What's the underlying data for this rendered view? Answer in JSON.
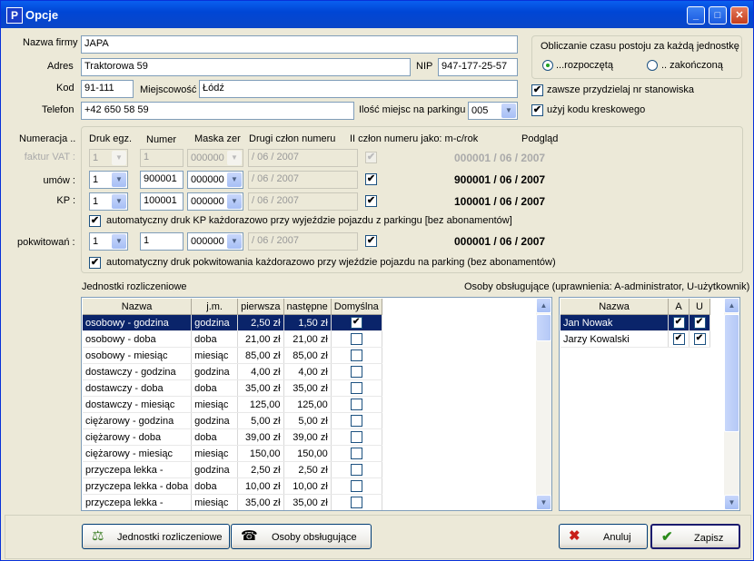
{
  "window": {
    "title": "Opcje",
    "app_letter": "P"
  },
  "company": {
    "name_label": "Nazwa firmy",
    "name_value": "JAPA",
    "address_label": "Adres",
    "address_value": "Traktorowa 59",
    "nip_label": "NIP",
    "nip_value": "947-177-25-57",
    "postcode_label": "Kod",
    "postcode_value": "91-111",
    "city_label": "Miejscowość",
    "city_value": "Łódź",
    "phone_label": "Telefon",
    "phone_value": "+42 650 58 59",
    "places_label": "Ilość miejsc na parkingu",
    "places_value": "005"
  },
  "time_calc": {
    "title": "Obliczanie czasu postoju za każdą jednostkę",
    "opt_started": "...rozpoczętą",
    "opt_finished": ".. zakończoną",
    "selected": "started"
  },
  "options": {
    "assign_stand": "zawsze przydzielaj nr stanowiska",
    "assign_stand_checked": true,
    "use_barcode": "użyj kodu kreskowego",
    "use_barcode_checked": true
  },
  "numbering": {
    "header": "Numeracja ..",
    "col_print": "Druk egz.",
    "col_number": "Numer",
    "col_mask": "Maska zer",
    "col_second": "Drugi człon numeru",
    "col_second_as": "II człon numeru jako: m-c/rok",
    "col_preview": "Podgląd",
    "rows": [
      {
        "label": "faktur VAT :",
        "copies": "1",
        "number": "1",
        "mask": "000000",
        "second": "/ 06 / 2007",
        "checked": true,
        "preview": "000001 / 06 / 2007",
        "disabled": true
      },
      {
        "label": "umów :",
        "copies": "1",
        "number": "900001",
        "mask": "000000",
        "second": "/ 06 / 2007",
        "checked": true,
        "preview": "900001 / 06 / 2007",
        "disabled": false
      },
      {
        "label": "KP :",
        "copies": "1",
        "number": "100001",
        "mask": "000000",
        "second": "/ 06 / 2007",
        "checked": true,
        "preview": "100001 / 06 / 2007",
        "disabled": false
      },
      {
        "label": "pokwitowań :",
        "copies": "1",
        "number": "1",
        "mask": "000000",
        "second": "/ 06 / 2007",
        "checked": true,
        "preview": "000001 / 06 / 2007",
        "disabled": false
      }
    ],
    "auto_kp": "automatyczny druk KP każdorazowo przy wyjeździe pojazdu z parkingu [bez abonamentów]",
    "auto_kp_checked": true,
    "auto_receipt": "automatyczny druk pokwitowania każdorazowo przy wjeździe pojazdu na parking (bez abonamentów)",
    "auto_receipt_checked": true
  },
  "units": {
    "title": "Jednostki rozliczeniowe",
    "columns": [
      "Nazwa",
      "j.m.",
      "pierwsza",
      "następne",
      "Domyślna"
    ],
    "rows": [
      {
        "name": "osobowy - godzina",
        "unit": "godzina",
        "first": "2,50 zł",
        "next": "1,50 zł",
        "default": true
      },
      {
        "name": "osobowy - doba",
        "unit": "doba",
        "first": "21,00 zł",
        "next": "21,00 zł",
        "default": false
      },
      {
        "name": "osobowy - miesiąc",
        "unit": "miesiąc",
        "first": "85,00 zł",
        "next": "85,00 zł",
        "default": false
      },
      {
        "name": "dostawczy - godzina",
        "unit": "godzina",
        "first": "4,00 zł",
        "next": "4,00 zł",
        "default": false
      },
      {
        "name": "dostawczy - doba",
        "unit": "doba",
        "first": "35,00 zł",
        "next": "35,00 zł",
        "default": false
      },
      {
        "name": "dostawczy - miesiąc",
        "unit": "miesiąc",
        "first": "125,00",
        "next": "125,00",
        "default": false
      },
      {
        "name": "ciężarowy - godzina",
        "unit": "godzina",
        "first": "5,00 zł",
        "next": "5,00 zł",
        "default": false
      },
      {
        "name": "ciężarowy - doba",
        "unit": "doba",
        "first": "39,00 zł",
        "next": "39,00 zł",
        "default": false
      },
      {
        "name": "ciężarowy - miesiąc",
        "unit": "miesiąc",
        "first": "150,00",
        "next": "150,00",
        "default": false
      },
      {
        "name": "przyczepa lekka -",
        "unit": "godzina",
        "first": "2,50 zł",
        "next": "2,50 zł",
        "default": false
      },
      {
        "name": "przyczepa lekka - doba",
        "unit": "doba",
        "first": "10,00 zł",
        "next": "10,00 zł",
        "default": false
      },
      {
        "name": "przyczepa lekka -",
        "unit": "miesiąc",
        "first": "35,00 zł",
        "next": "35,00 zł",
        "default": false
      }
    ]
  },
  "users": {
    "title": "Osoby obsługujące (uprawnienia: A-administrator, U-użytkownik)",
    "columns": [
      "Nazwa",
      "A",
      "U"
    ],
    "rows": [
      {
        "name": "Jan Nowak",
        "a": true,
        "u": true
      },
      {
        "name": "Jarzy Kowalski",
        "a": true,
        "u": true
      }
    ]
  },
  "buttons": {
    "units": "Jednostki rozliczeniowe",
    "users": "Osoby obsługujące",
    "cancel": "Anuluj",
    "save": "Zapisz"
  },
  "glyphs": {
    "check": "✔",
    "arrow_down": "▼",
    "arrow_up": "▲"
  }
}
